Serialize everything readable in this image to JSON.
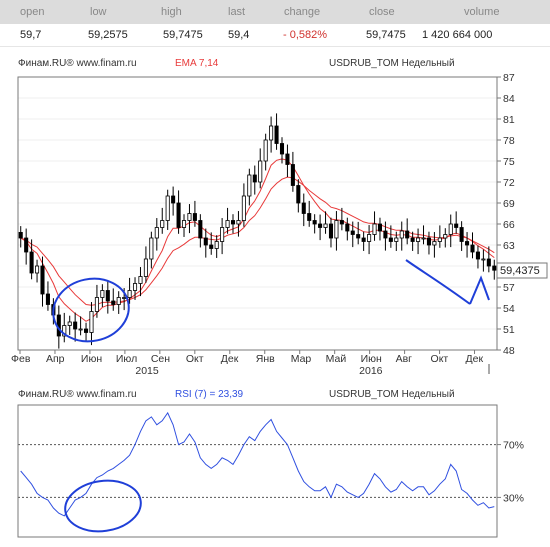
{
  "quote": {
    "headers": [
      "open",
      "low",
      "high",
      "last",
      "change",
      "close",
      "volume"
    ],
    "values": [
      "59,7",
      "59,2575",
      "59,7475",
      "59,4",
      "- 0,582%",
      "59,7475",
      "1 420 664 000"
    ]
  },
  "price_panel": {
    "source": "Финам.RU®  www.finam.ru",
    "indicator": "EMA 7,14",
    "instrument": "USDRUB_TOM Недельный",
    "last_price": "59,4375"
  },
  "rsi_panel": {
    "source": "Финам.RU®  www.finam.ru",
    "indicator": "RSI (7) = 23,39",
    "instrument": "USDRUB_TOM Недельный"
  },
  "colors": {
    "header_bg": "#dcdcdc",
    "candle_up": "#ffffff",
    "candle_down": "#000000",
    "ema": "#e83a3a",
    "rsi": "#3050e0",
    "annotation": "#1f3fd8",
    "change_negative": "#d0312d"
  },
  "chart_data": [
    {
      "type": "candlestick",
      "x_tick_labels": [
        "Фев",
        "Апр",
        "Июн",
        "Июл",
        "Сен",
        "Окт",
        "Дек",
        "Янв",
        "Мар",
        "Май",
        "Июн",
        "Авг",
        "Окт",
        "Дек"
      ],
      "year_labels": [
        "2015",
        "2016"
      ],
      "y_tick_labels": [
        "48",
        "51",
        "54",
        "57",
        "60",
        "63",
        "66",
        "69",
        "72",
        "75",
        "78",
        "81",
        "84",
        "87"
      ],
      "ylim": [
        48,
        87
      ],
      "close": [
        64.0,
        62.0,
        59.0,
        60.0,
        56.0,
        54.5,
        53.0,
        50.0,
        51.5,
        52.0,
        51.0,
        51.0,
        50.5,
        53.5,
        55.5,
        56.5,
        55.0,
        54.5,
        55.5,
        55.5,
        56.5,
        57.5,
        58.5,
        61.0,
        64.0,
        65.5,
        66.5,
        70.0,
        69.0,
        65.5,
        66.5,
        67.5,
        66.5,
        64.0,
        63.0,
        62.5,
        63.5,
        65.5,
        66.5,
        66.0,
        66.5,
        70.0,
        73.0,
        72.0,
        75.0,
        78.0,
        80.0,
        77.5,
        76.0,
        74.5,
        71.5,
        69.0,
        67.5,
        66.5,
        66.0,
        65.5,
        66.0,
        64.0,
        66.5,
        66.0,
        65.0,
        64.5,
        64.0,
        63.5,
        64.5,
        66.0,
        65.0,
        64.0,
        63.5,
        64.0,
        65.0,
        64.0,
        63.5,
        64.0,
        64.0,
        63.0,
        63.5,
        64.0,
        64.5,
        66.0,
        65.5,
        63.5,
        63.0,
        62.0,
        61.0,
        61.0,
        60.0,
        59.4
      ],
      "ema_series": [
        {
          "name": "EMA 7",
          "values": [
            64.0,
            63.5,
            62.4,
            61.8,
            60.4,
            59.0,
            57.5,
            55.6,
            54.6,
            53.9,
            53.2,
            52.7,
            52.1,
            52.5,
            53.3,
            54.1,
            54.4,
            54.4,
            54.7,
            54.9,
            55.3,
            55.9,
            56.5,
            57.7,
            59.3,
            60.8,
            62.2,
            64.2,
            65.4,
            65.4,
            65.7,
            66.2,
            66.3,
            65.7,
            65.0,
            64.4,
            64.2,
            64.5,
            65.0,
            65.3,
            65.6,
            66.7,
            68.3,
            69.3,
            70.7,
            72.5,
            74.4,
            75.1,
            75.3,
            75.1,
            74.2,
            72.9,
            71.5,
            70.3,
            69.2,
            68.2,
            67.6,
            66.7,
            66.6,
            66.5,
            66.1,
            65.7,
            65.3,
            64.9,
            64.8,
            65.1,
            65.1,
            64.8,
            64.5,
            64.4,
            64.5,
            64.4,
            64.1,
            64.1,
            64.0,
            63.8,
            63.7,
            63.8,
            64.0,
            64.5,
            64.7,
            64.4,
            64.0,
            63.5,
            62.9,
            62.4,
            61.8,
            61.2
          ]
        },
        {
          "name": "EMA 14",
          "values": [
            64.0,
            63.7,
            63.1,
            62.7,
            61.8,
            60.9,
            59.9,
            58.6,
            57.7,
            56.8,
            55.9,
            55.2,
            54.5,
            54.4,
            54.5,
            54.8,
            54.8,
            54.8,
            54.9,
            55.0,
            55.2,
            55.5,
            55.9,
            56.6,
            57.6,
            58.6,
            59.7,
            61.1,
            62.2,
            62.6,
            63.1,
            63.7,
            64.1,
            64.1,
            63.9,
            63.8,
            63.7,
            64.0,
            64.4,
            64.6,
            64.8,
            65.5,
            66.5,
            67.2,
            68.3,
            69.6,
            71.0,
            71.8,
            72.4,
            72.7,
            72.6,
            72.1,
            71.5,
            70.8,
            70.2,
            69.6,
            69.1,
            68.4,
            68.2,
            67.9,
            67.5,
            67.1,
            66.7,
            66.3,
            66.1,
            66.1,
            65.9,
            65.6,
            65.3,
            65.1,
            65.1,
            64.9,
            64.6,
            64.5,
            64.4,
            64.2,
            64.1,
            64.0,
            64.1,
            64.3,
            64.4,
            64.2,
            64.0,
            63.6,
            63.2,
            62.8,
            62.4,
            61.9
          ]
        }
      ]
    },
    {
      "type": "line",
      "y_tick_labels": [
        "70%",
        "30%"
      ],
      "ylim": [
        0,
        100
      ],
      "series": [
        {
          "name": "RSI (7) = 23,39",
          "values": [
            50,
            45,
            40,
            33,
            30,
            28,
            22,
            18,
            16,
            22,
            28,
            30,
            33,
            40,
            45,
            47,
            50,
            52,
            55,
            58,
            62,
            70,
            80,
            88,
            91,
            85,
            88,
            94,
            85,
            70,
            72,
            78,
            72,
            60,
            55,
            52,
            55,
            60,
            58,
            55,
            62,
            70,
            76,
            73,
            80,
            85,
            89,
            80,
            75,
            70,
            60,
            50,
            42,
            38,
            35,
            35,
            38,
            30,
            40,
            38,
            34,
            32,
            30,
            33,
            40,
            48,
            44,
            38,
            34,
            36,
            42,
            38,
            35,
            38,
            38,
            32,
            35,
            40,
            44,
            55,
            50,
            36,
            33,
            28,
            24,
            26,
            22,
            23
          ]
        }
      ]
    }
  ]
}
